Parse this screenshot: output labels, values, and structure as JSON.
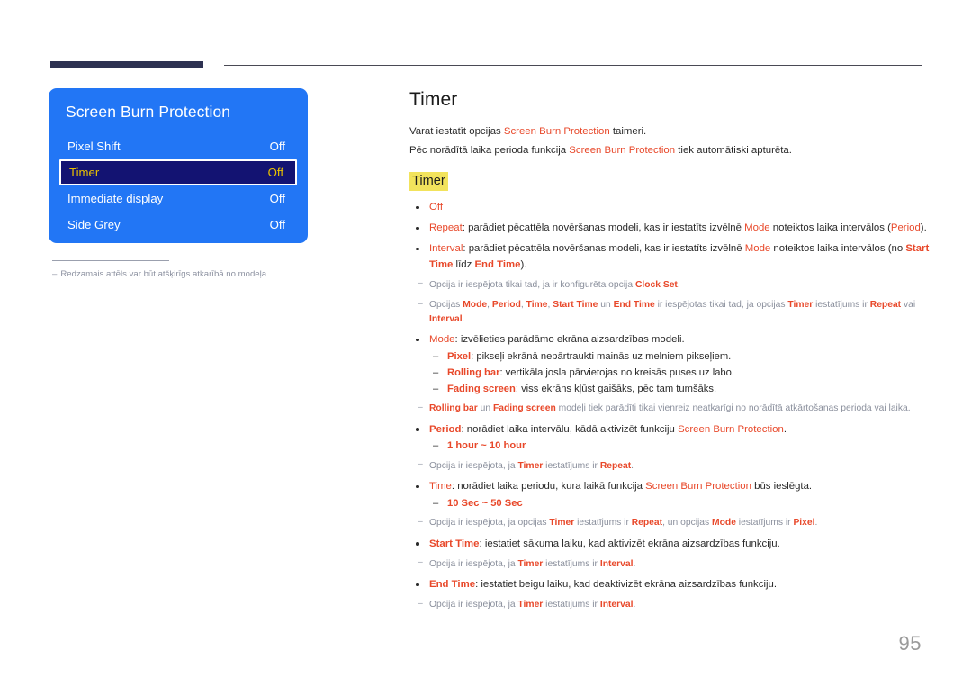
{
  "header": {
    "rule_label": "section-rule"
  },
  "osd": {
    "title": "Screen Burn Protection",
    "rows": [
      {
        "label": "Pixel Shift",
        "value": "Off",
        "selected": false
      },
      {
        "label": "Timer",
        "value": "Off",
        "selected": true
      },
      {
        "label": "Immediate display",
        "value": "Off",
        "selected": false
      },
      {
        "label": "Side Grey",
        "value": "Off",
        "selected": false
      }
    ],
    "colors": {
      "panel_bg": "#2276f5",
      "selected_bg": "#131372",
      "selected_text": "#e8c000",
      "text": "#ffffff"
    }
  },
  "left_note": {
    "dash": "‒",
    "text": "Redzamais attēls var būt atšķirīgs atkarībā no modeļa."
  },
  "content": {
    "title": "Timer",
    "intro": [
      {
        "pre": "Varat iestatīt opcijas ",
        "kw": "Screen Burn Protection",
        "post": " taimeri."
      },
      {
        "pre": "Pēc norādītā laika perioda funkcija ",
        "kw": "Screen Burn Protection",
        "post": " tiek automātiski apturēta."
      }
    ],
    "sub_title": "Timer",
    "items": [
      {
        "type": "bullet",
        "html": "<span class=\"kw\">Off</span>"
      },
      {
        "type": "bullet",
        "html": " <span class=\"kw\">Repeat</span>: parādiet pēcattēla novēršanas modeli, kas ir iestatīts izvēlnē <span class=\"kw\">Mode</span> noteiktos laika intervālos (<span class=\"kw\">Period</span>)."
      },
      {
        "type": "bullet",
        "html": "<span class=\"kw\">Interval</span>: parādiet pēcattēla novēršanas modeli, kas ir iestatīts izvēlnē <span class=\"kw\">Mode</span> noteiktos laika intervālos (no <span class=\"kw-b\">Start Time</span> līdz <span class=\"kw-b\">End Time</span>)."
      },
      {
        "type": "note",
        "html": "Opcija ir iespējota tikai tad, ja ir konfigurēta opcija <span class=\"kw-b\">Clock Set</span>."
      },
      {
        "type": "note",
        "html": "Opcijas <span class=\"kw-b\">Mode</span>, <span class=\"kw-b\">Period</span>, <span class=\"kw-b\">Time</span>, <span class=\"kw-b\">Start Time</span> un <span class=\"kw-b\">End Time</span> ir iespējotas tikai tad, ja opcijas <span class=\"kw-b\">Timer</span> iestatījums ir <span class=\"kw-b\">Repeat</span> vai <span class=\"kw-b\">Interval</span>."
      },
      {
        "type": "bullet",
        "html": "<span class=\"kw\">Mode</span>: izvēlieties parādāmo ekrāna aizsardzības modeli.",
        "sub": [
          "<span class=\"kw-b\">Pixel</span>: pikseļi ekrānā nepārtraukti mainās uz melniem pikseļiem.",
          "<span class=\"kw-b\">Rolling bar</span>: vertikāla josla pārvietojas no kreisās puses uz labo.",
          "<span class=\"kw-b\">Fading screen</span>: viss ekrāns kļūst gaišāks, pēc tam tumšāks."
        ]
      },
      {
        "type": "note",
        "html": "<span class=\"kw-b\">Rolling bar</span> un <span class=\"kw-b\">Fading screen</span> modeļi tiek parādīti tikai vienreiz neatkarīgi no norādītā atkārtošanas perioda vai laika."
      },
      {
        "type": "bullet",
        "html": "<span class=\"kw-b\">Period</span>: norādiet laika intervālu, kādā aktivizēt funkciju <span class=\"kw\">Screen Burn Protection</span>.",
        "sub": [
          " <span class=\"kw-b\">1 hour ~ 10 hour</span>"
        ]
      },
      {
        "type": "note",
        "html": "Opcija ir iespējota, ja <span class=\"kw-b\">Timer</span> iestatījums ir <span class=\"kw-b\">Repeat</span>."
      },
      {
        "type": "bullet",
        "html": "<span class=\"kw\">Time</span>: norādiet laika periodu, kura laikā funkcija <span class=\"kw\">Screen Burn Protection</span> būs ieslēgta.",
        "sub": [
          " <span class=\"kw-b\">10 Sec ~ 50 Sec</span>"
        ]
      },
      {
        "type": "note",
        "html": "Opcija ir iespējota, ja opcijas <span class=\"kw-b\">Timer</span> iestatījums ir <span class=\"kw-b\">Repeat</span>, un opcijas <span class=\"kw-b\">Mode</span> iestatījums ir <span class=\"kw-b\">Pixel</span>."
      },
      {
        "type": "bullet",
        "html": "<span class=\"kw-b\">Start Time</span>: iestatiet sākuma laiku, kad aktivizēt ekrāna aizsardzības funkciju."
      },
      {
        "type": "note",
        "html": "Opcija ir iespējota, ja <span class=\"kw-b\">Timer</span> iestatījums ir <span class=\"kw-b\">Interval</span>."
      },
      {
        "type": "bullet",
        "html": "<span class=\"kw-b\">End Time</span>: iestatiet beigu laiku, kad deaktivizēt ekrāna aizsardzības funkciju."
      },
      {
        "type": "note",
        "html": "Opcija ir iespējota, ja <span class=\"kw-b\">Timer</span> iestatījums ir <span class=\"kw-b\">Interval</span>."
      }
    ],
    "note_dash": "‒",
    "sub_dash": "–"
  },
  "footer": {
    "page_number": "95"
  },
  "colors": {
    "keyword": "#e8482a",
    "highlight": "#f2e35c",
    "header_tab": "#2e3252",
    "note_text": "#8a8f9c"
  }
}
